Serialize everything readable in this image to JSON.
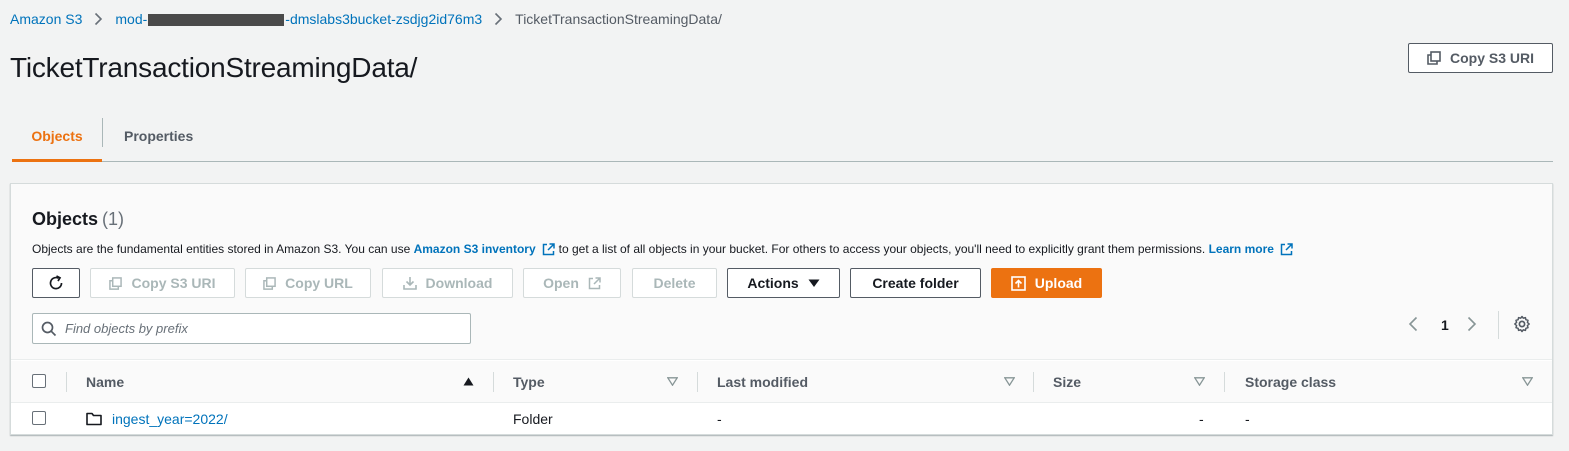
{
  "breadcrumb": {
    "root": "Amazon S3",
    "bucket_prefix": "mod-",
    "bucket_suffix": "-dmslabs3bucket-zsdjg2id76m3",
    "current": "TicketTransactionStreamingData/"
  },
  "header": {
    "title": "TicketTransactionStreamingData/",
    "copy_uri_label": "Copy S3 URI"
  },
  "tabs": [
    {
      "label": "Objects",
      "active": true
    },
    {
      "label": "Properties",
      "active": false
    }
  ],
  "objects_panel": {
    "title": "Objects",
    "count": "(1)",
    "description_part1": "Objects are the fundamental entities stored in Amazon S3. You can use",
    "inventory_link": "Amazon S3 inventory",
    "description_part2": "to get a list of all objects in your bucket. For others to access your objects, you'll need to explicitly grant them permissions.",
    "learn_more": "Learn more",
    "toolbar": {
      "copy_s3_uri": "Copy S3 URI",
      "copy_url": "Copy URL",
      "download": "Download",
      "open": "Open",
      "delete": "Delete",
      "actions": "Actions",
      "create_folder": "Create folder",
      "upload": "Upload"
    },
    "search": {
      "placeholder": "Find objects by prefix",
      "value": ""
    },
    "pagination": {
      "current_page": "1"
    }
  },
  "table": {
    "columns": [
      "Name",
      "Type",
      "Last modified",
      "Size",
      "Storage class"
    ],
    "rows": [
      {
        "name": "ingest_year=2022/",
        "type": "Folder",
        "last_modified": "-",
        "size": "-",
        "storage_class": "-"
      }
    ]
  },
  "colors": {
    "accent": "#ec7211",
    "link": "#0073bb",
    "background": "#f2f3f3"
  }
}
